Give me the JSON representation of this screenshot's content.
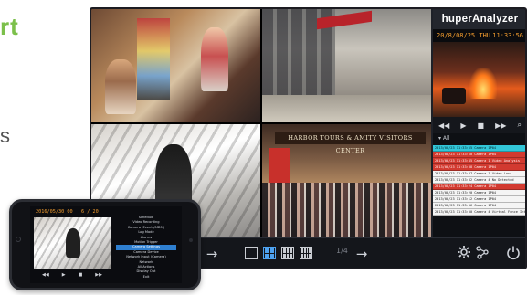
{
  "page": {
    "brand_fragment": "rt",
    "side_fragment": "s"
  },
  "monitor": {
    "cameras": [
      {
        "id": "cam-1",
        "overlay": ""
      },
      {
        "id": "cam-2",
        "overlay": ""
      },
      {
        "id": "cam-3",
        "overlay": ""
      },
      {
        "id": "cam-4",
        "overlay": "HARBOR TOURS & AMITY VISITORS CENTER"
      }
    ],
    "bottom_bar": {
      "page_counter": "1/4",
      "arrow_glyph": "→"
    }
  },
  "panel": {
    "title": "huperAnalyzer",
    "date": "20/8/08/25 THU",
    "time": "11:33:56",
    "filter_label": "▾ All",
    "controls": [
      "◀◀",
      "▶",
      "■",
      "▶▶",
      "⌕"
    ],
    "events": [
      {
        "text": "2013/08/23 11:33:55 Camera 1P04",
        "style": "cyan"
      },
      {
        "text": "2013/08/23 11:33:50 Camera 1P04",
        "style": "red"
      },
      {
        "text": "2013/08/23 11:33:45 Camera 1 Video Analysis",
        "style": "red"
      },
      {
        "text": "2013/08/23 11:33:38 Camera 1P04",
        "style": "red"
      },
      {
        "text": "2013/08/23 11:33:37 Camera 1 Video Loss",
        "style": "white"
      },
      {
        "text": "2013/08/23 11:33:32 Camera 4 No Detected",
        "style": "white"
      },
      {
        "text": "2013/08/23 11:33:24 Camera 1P04",
        "style": "red"
      },
      {
        "text": "2013/08/23 11:33:20 Camera 1P04",
        "style": "white"
      },
      {
        "text": "2013/08/23 11:33:12 Camera 1P04",
        "style": "white"
      },
      {
        "text": "2013/08/23 11:33:06 Camera 1P04",
        "style": "white"
      },
      {
        "text": "2013/08/23 11:33:00 Camera 4 Virtual Fence Intrusion",
        "style": "white"
      }
    ],
    "colors": {
      "accent": "#f29c2e",
      "alert": "#d23a30",
      "highlight": "#32c6d8"
    }
  },
  "phone": {
    "date": "2016/05/30 00",
    "time": "6 / 20",
    "controls": [
      "◀◀",
      "▶",
      "■",
      "▶▶"
    ],
    "menu": [
      {
        "label": "Schedule",
        "selected": false
      },
      {
        "label": "Video Recording",
        "selected": false
      },
      {
        "label": "Camera (Events/MDM)",
        "selected": false
      },
      {
        "label": "Log Mode",
        "selected": false
      },
      {
        "label": "Alarms",
        "selected": false
      },
      {
        "label": "Motion Trigger",
        "selected": false
      },
      {
        "label": "Camera Settings",
        "selected": true
      },
      {
        "label": "Camera Device",
        "selected": false
      },
      {
        "label": "Network Input (Camera)",
        "selected": false
      },
      {
        "label": "Network",
        "selected": false
      },
      {
        "label": "All Actions",
        "selected": false
      },
      {
        "label": "Display Out",
        "selected": false
      },
      {
        "label": "Exit",
        "selected": false
      }
    ]
  }
}
